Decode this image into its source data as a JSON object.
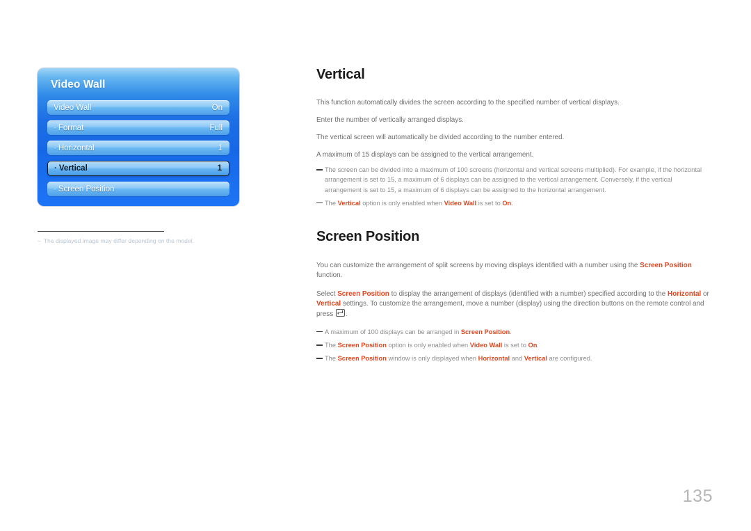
{
  "osd": {
    "title": "Video Wall",
    "rows": [
      {
        "bullet": "",
        "label": "Video Wall",
        "value": "On",
        "selected": false
      },
      {
        "bullet": "·",
        "label": "Format",
        "value": "Full",
        "selected": false
      },
      {
        "bullet": "·",
        "label": "Horizontal",
        "value": "1",
        "selected": false
      },
      {
        "bullet": "·",
        "label": "Vertical",
        "value": "1",
        "selected": true
      },
      {
        "bullet": "·",
        "label": "Screen Position",
        "value": "",
        "selected": false
      }
    ]
  },
  "left_note": {
    "dash": "–",
    "text": "The displayed image may differ depending on the model."
  },
  "vertical_section": {
    "heading": "Vertical",
    "paragraphs": [
      "This function automatically divides the screen according to the specified number of vertical displays.",
      "Enter the number of vertically arranged displays.",
      "The vertical screen will automatically be divided according to the number entered.",
      "A maximum of 15 displays can be assigned to the vertical arrangement."
    ],
    "notes": [
      {
        "parts": [
          {
            "t": "The screen can be divided into a maximum of 100 screens (horizontal and vertical screens multiplied). For example, if the horizontal arrangement is set to 15, a maximum of 6 displays can be assigned to the vertical arrangement. Conversely, if the vertical arrangement is set to 15, a maximum of 6 displays can be assigned to the horizontal arrangement.",
            "red": false
          }
        ]
      },
      {
        "parts": [
          {
            "t": "The ",
            "red": false
          },
          {
            "t": "Vertical",
            "red": true
          },
          {
            "t": " option is only enabled when ",
            "red": false
          },
          {
            "t": "Video Wall",
            "red": true
          },
          {
            "t": " is set to ",
            "red": false
          },
          {
            "t": "On",
            "red": true
          },
          {
            "t": ".",
            "red": false
          }
        ]
      }
    ]
  },
  "screen_position_section": {
    "heading": "Screen Position",
    "paragraph1": [
      {
        "t": "You can customize the arrangement of split screens by moving displays identified with a number using the ",
        "red": false
      },
      {
        "t": "Screen Position",
        "red": true
      },
      {
        "t": " function.",
        "red": false
      }
    ],
    "paragraph2_a": [
      {
        "t": "Select ",
        "red": false
      },
      {
        "t": "Screen Position",
        "red": true
      },
      {
        "t": " to display the arrangement of displays (identified with a number) specified according to the ",
        "red": false
      },
      {
        "t": "Horizontal",
        "red": true
      },
      {
        "t": " or ",
        "red": false
      },
      {
        "t": "Vertical",
        "red": true
      },
      {
        "t": " settings. To customize the arrangement, move a number (display) using the direction buttons on the remote control and press ",
        "red": false
      }
    ],
    "paragraph2_icon": "enter-key-icon",
    "paragraph2_b": ".",
    "notes": [
      {
        "parts": [
          {
            "t": "A maximum of 100 displays can be arranged in ",
            "red": false
          },
          {
            "t": "Screen Position",
            "red": true
          },
          {
            "t": ".",
            "red": false
          }
        ]
      },
      {
        "parts": [
          {
            "t": "The ",
            "red": false
          },
          {
            "t": "Screen Position",
            "red": true
          },
          {
            "t": " option is only enabled when ",
            "red": false
          },
          {
            "t": "Video Wall",
            "red": true
          },
          {
            "t": " is set to ",
            "red": false
          },
          {
            "t": "On",
            "red": true
          },
          {
            "t": ".",
            "red": false
          }
        ]
      },
      {
        "parts": [
          {
            "t": "The ",
            "red": false
          },
          {
            "t": "Screen Position",
            "red": true
          },
          {
            "t": " window is only displayed when ",
            "red": false
          },
          {
            "t": "Horizontal",
            "red": true
          },
          {
            "t": " and ",
            "red": false
          },
          {
            "t": "Vertical",
            "red": true
          },
          {
            "t": " are configured.",
            "red": false
          }
        ]
      }
    ]
  },
  "page_number": "135",
  "colors": {
    "accent_red": "#e0461f",
    "osd_blue": "#1d6ee4",
    "body_gray": "#6e6e6e",
    "note_gray": "#8d8d8d",
    "page_number_gray": "#b6b6b6"
  }
}
